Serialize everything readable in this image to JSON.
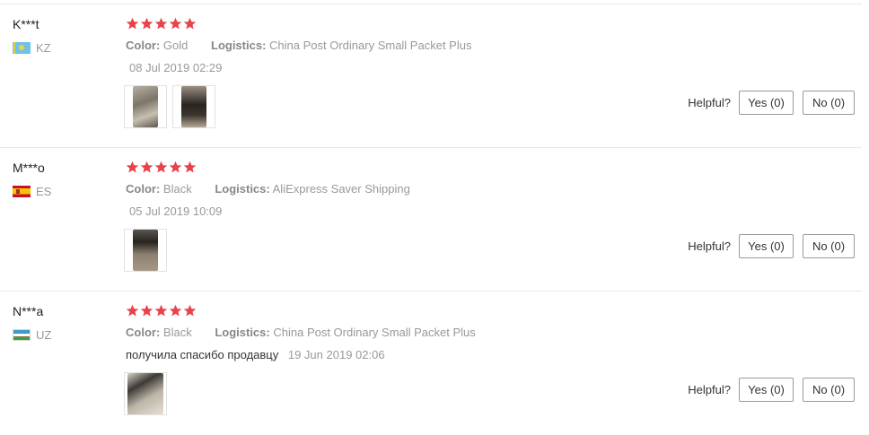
{
  "colors": {
    "star": "#e8434a"
  },
  "labels": {
    "color_key": "Color:",
    "logistics_key": "Logistics:",
    "helpful": "Helpful?"
  },
  "reviews": [
    {
      "user": "K***t",
      "country": "KZ",
      "flag_icon": "kazakhstan-flag-icon",
      "rating": 5,
      "color": "Gold",
      "logistics": "China Post Ordinary Small Packet Plus",
      "text": "",
      "date": "08 Jul 2019 02:29",
      "photos": 2,
      "yes_label": "Yes (0)",
      "no_label": "No (0)"
    },
    {
      "user": "M***o",
      "country": "ES",
      "flag_icon": "spain-flag-icon",
      "rating": 5,
      "color": "Black",
      "logistics": "AliExpress Saver Shipping",
      "text": "",
      "date": "05 Jul 2019 10:09",
      "photos": 1,
      "yes_label": "Yes (0)",
      "no_label": "No (0)"
    },
    {
      "user": "N***a",
      "country": "UZ",
      "flag_icon": "uzbekistan-flag-icon",
      "rating": 5,
      "color": "Black",
      "logistics": "China Post Ordinary Small Packet Plus",
      "text": "получила спасибо продавцу",
      "date": "19 Jun 2019 02:06",
      "photos": 1,
      "yes_label": "Yes (0)",
      "no_label": "No (0)"
    }
  ]
}
